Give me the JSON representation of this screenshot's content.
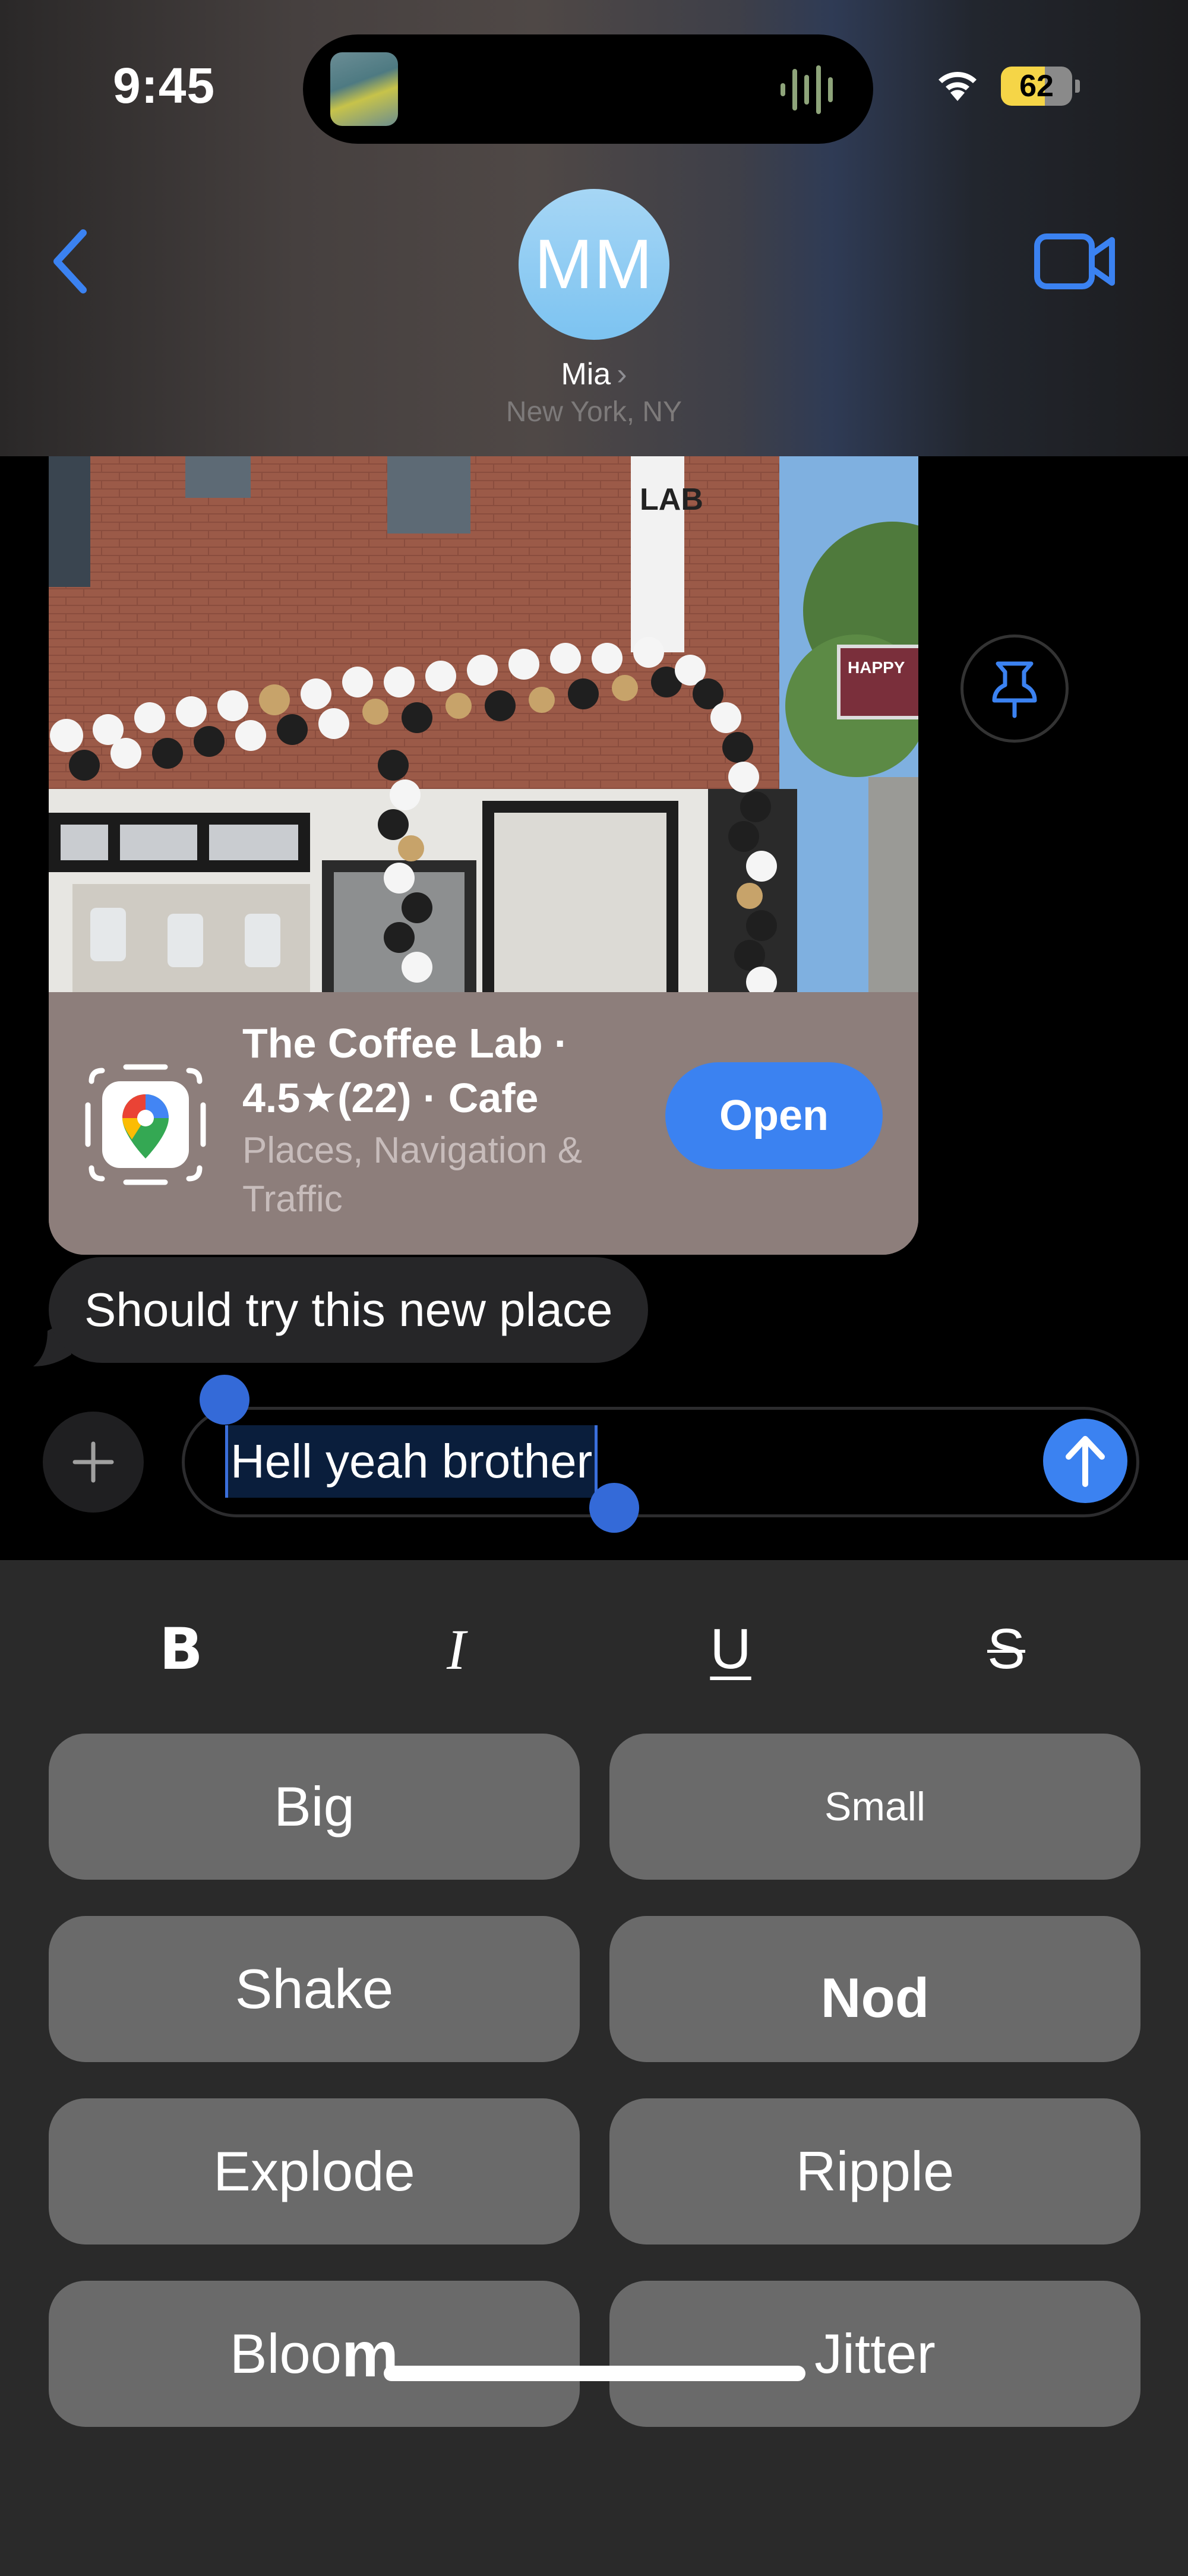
{
  "status_bar": {
    "time": "9:45",
    "battery_percent": "62",
    "battery_level": 0.62,
    "icons": [
      "now-playing-artwork",
      "audio-waveform-icon",
      "wifi-icon",
      "battery-icon"
    ]
  },
  "header": {
    "back_icon": "chevron-left-icon",
    "avatar_initials": "MM",
    "contact_name": "Mia",
    "contact_chevron": "›",
    "contact_location": "New York, NY",
    "video_icon": "video-camera-icon",
    "accent_color": "#3b82f1"
  },
  "conversation": {
    "rich_link": {
      "image_description": "Storefront of The Coffee Lab decorated with black, white and gold balloons",
      "title": "The Coffee Lab · 4.5★(22) · Cafe",
      "subtitle": "Places, Navigation & Traffic",
      "app_icon": "google-maps-icon",
      "open_label": "Open"
    },
    "pin_icon": "pin-icon",
    "messages": [
      {
        "direction": "incoming",
        "text": "Should try this new place"
      }
    ]
  },
  "composer": {
    "plus_icon": "plus-icon",
    "value": "Hell yeah brother",
    "selection": "Hell yeah brother",
    "send_icon": "arrow-up-icon"
  },
  "formatting": {
    "styles": [
      {
        "id": "bold",
        "label": "B"
      },
      {
        "id": "italic",
        "label": "I"
      },
      {
        "id": "underline",
        "label": "U"
      },
      {
        "id": "strikethrough",
        "label": "S"
      }
    ],
    "effects": [
      {
        "id": "big",
        "label": "Big"
      },
      {
        "id": "small",
        "label": "Small"
      },
      {
        "id": "shake",
        "label": "Shake"
      },
      {
        "id": "nod",
        "label": "Nod"
      },
      {
        "id": "explode",
        "label": "Explode"
      },
      {
        "id": "ripple",
        "label": "Ripple"
      },
      {
        "id": "bloom",
        "label_start": "Bloo",
        "label_end": "m",
        "label": "Bloom"
      },
      {
        "id": "jitter",
        "label": "Jitter"
      }
    ]
  }
}
